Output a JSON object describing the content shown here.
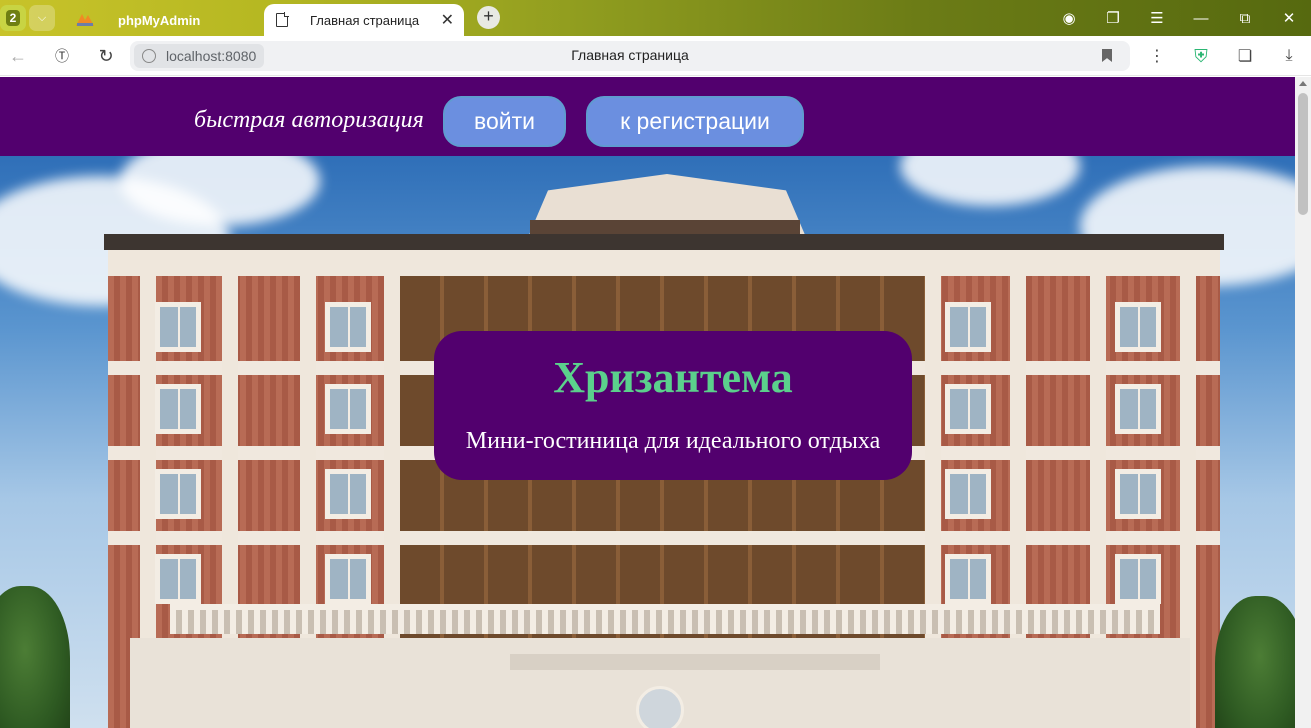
{
  "browser": {
    "tab_count": "2",
    "tabs": [
      {
        "title": "phpMyAdmin",
        "active": false
      },
      {
        "title": "Главная страница",
        "active": true
      }
    ],
    "address": {
      "host": "localhost:8080",
      "page_title": "Главная страница"
    }
  },
  "header": {
    "quick_auth_text": "быстрая авторизация",
    "login_label": "войти",
    "register_label": "к регистрации",
    "background_color": "#52006e",
    "button_color": "#6b8fe0"
  },
  "hero": {
    "hotel_name": "Хризантема",
    "tagline": "Мини-гостиница для идеального отдыха",
    "name_color": "#5bd08c"
  }
}
